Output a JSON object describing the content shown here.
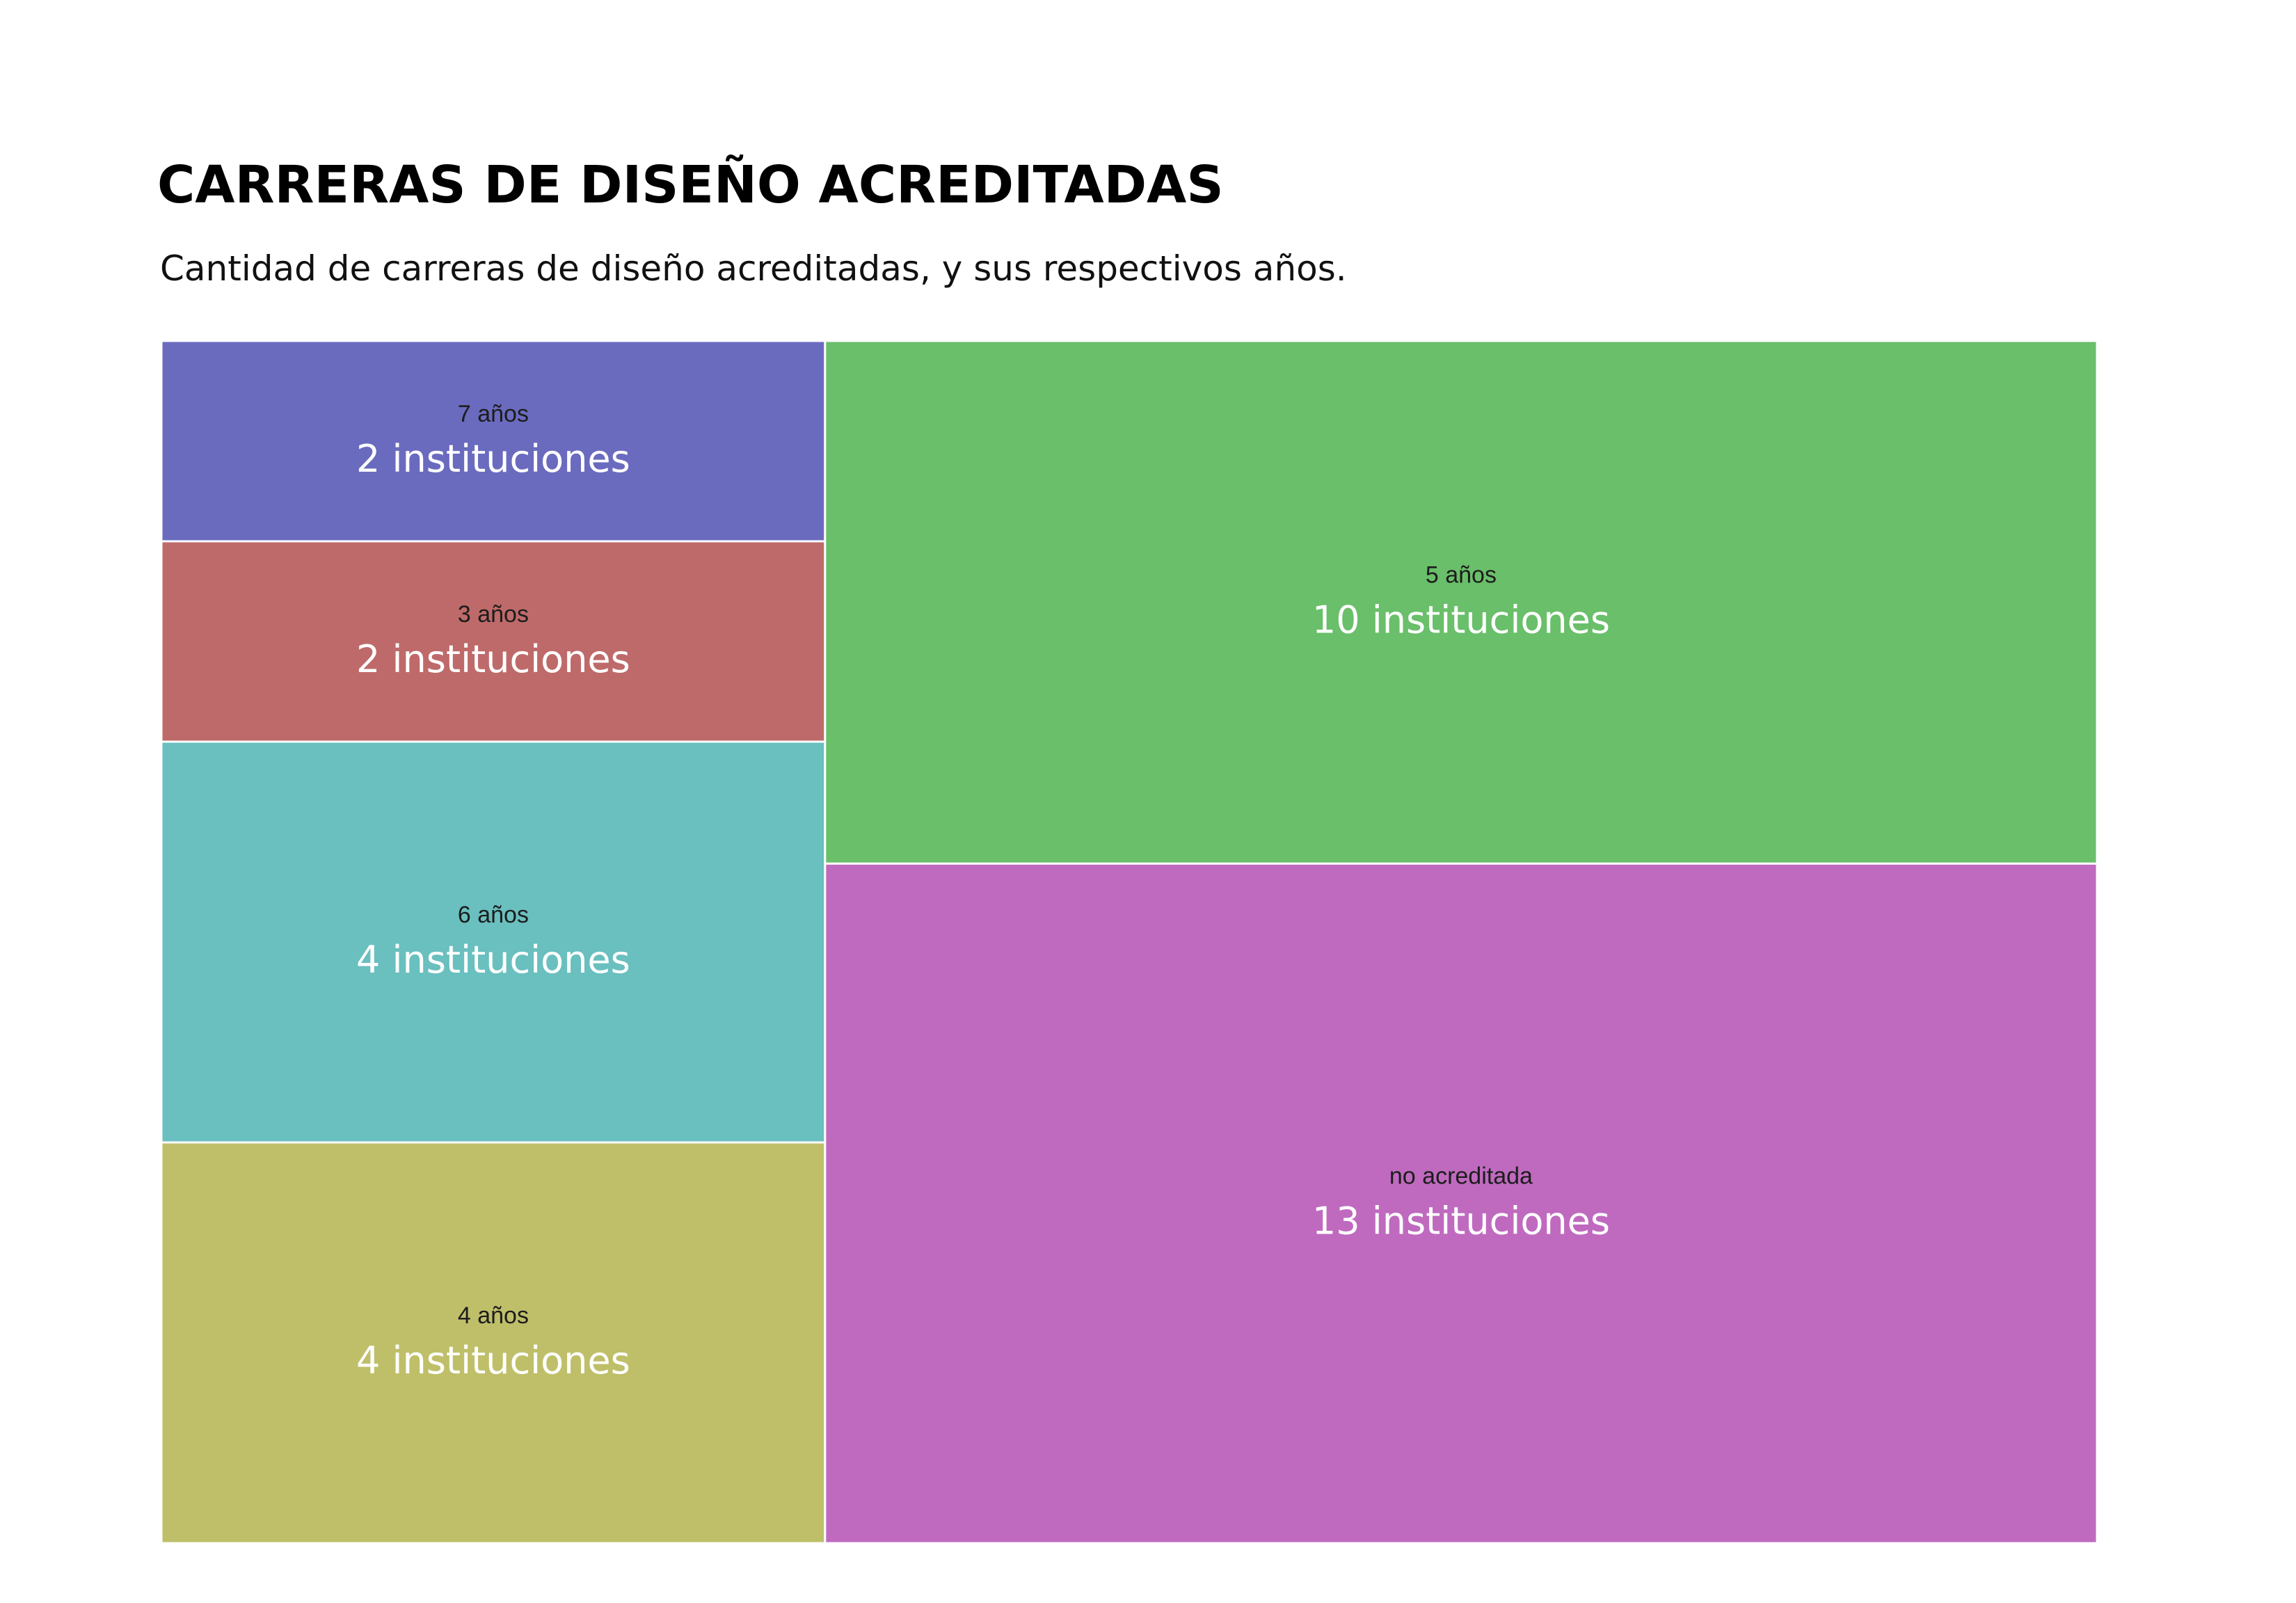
{
  "chart_data": {
    "type": "treemap",
    "title": "CARRERAS DE DISEÑO ACREDITADAS",
    "subtitle": "Cantidad de carreras de diseño acreditadas, y sus respectivos años.",
    "cells": [
      {
        "category": "7 años",
        "value": 2,
        "value_label": "2 instituciones",
        "color": "#6a6bbf"
      },
      {
        "category": "3 años",
        "value": 2,
        "value_label": "2 instituciones",
        "color": "#bf6a6a"
      },
      {
        "category": "6 años",
        "value": 4,
        "value_label": "4 instituciones",
        "color": "#6abfbf"
      },
      {
        "category": "4 años",
        "value": 4,
        "value_label": "4 instituciones",
        "color": "#bfbf6a"
      },
      {
        "category": "5 años",
        "value": 10,
        "value_label": "10 instituciones",
        "color": "#6abf6a"
      },
      {
        "category": "no acreditada",
        "value": 13,
        "value_label": "13 instituciones",
        "color": "#bf6abf"
      }
    ],
    "grid": false,
    "legend": "none"
  }
}
